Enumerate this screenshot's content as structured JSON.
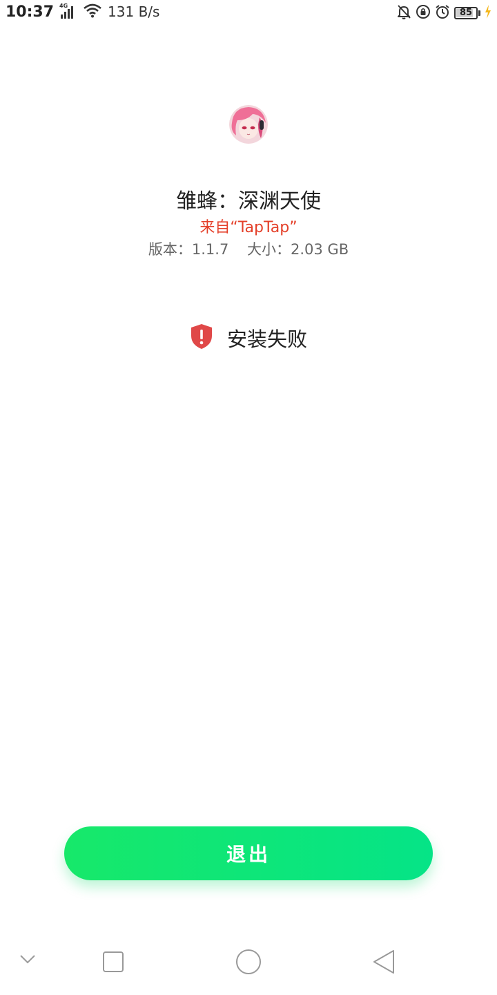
{
  "status_bar": {
    "time": "10:37",
    "network": "4G",
    "speed": "131 B/s",
    "battery": "85",
    "battery_level": 0.85,
    "icons": [
      "signal-icon",
      "wifi-icon",
      "mute-icon",
      "rotation-lock-icon",
      "alarm-icon",
      "battery-icon",
      "charging-icon"
    ]
  },
  "app": {
    "icon": "app-avatar-icon",
    "name": "雏蜂：深渊天使",
    "source": "来自“TapTap”",
    "version_label": "版本：1.1.7",
    "size_label": "大小：2.03 GB"
  },
  "install": {
    "status_text": "安装失败",
    "status_icon": "shield-alert-icon"
  },
  "actions": {
    "exit_label": "退出"
  },
  "nav": {
    "icons": [
      "chevron-down-icon",
      "recents-icon",
      "home-icon",
      "back-icon"
    ]
  },
  "colors": {
    "accent_green": "#0BE57B",
    "source_red": "#E4402A",
    "error_red": "#E04848"
  }
}
